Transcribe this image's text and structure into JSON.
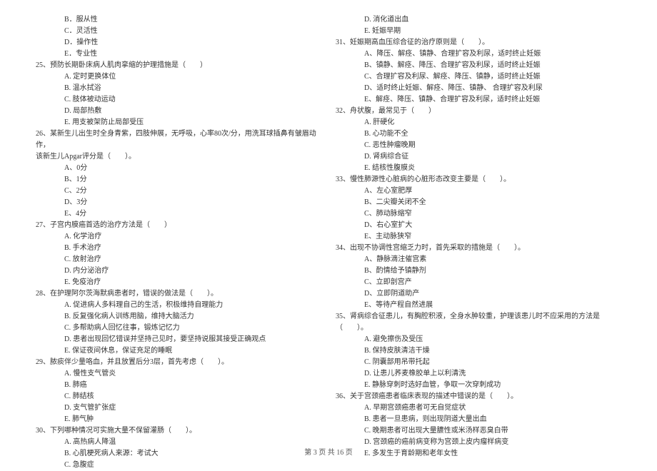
{
  "left_column": {
    "q24_options": [
      "B．服从性",
      "C．灵活性",
      "D．操作性",
      "E．专业性"
    ],
    "q25": {
      "text": "25、预防长期卧床病人肌肉挛缩的护理措施是（　　）",
      "options": [
        "A. 定时更换体位",
        "B. 温水拭浴",
        "C. 肢体被动运动",
        "D. 局部热敷",
        "E. 用支被架防止局部受压"
      ]
    },
    "q26": {
      "text": "26、某新生儿出生时全身青紫，四肢伸展，无呼吸，心率80次/分，用洗耳球插鼻有皱眉动作，",
      "text2": "该新生儿Apgar评分是（　　）。",
      "options": [
        "A、0分",
        "B、1分",
        "C、2分",
        "D、3分",
        "E、4分"
      ]
    },
    "q27": {
      "text": "27、子宫内膜癌首选的治疗方法是（　　）",
      "options": [
        "A. 化学治疗",
        "B. 手术治疗",
        "C. 放射治疗",
        "D. 内分泌治疗",
        "E. 免疫治疗"
      ]
    },
    "q28": {
      "text": "28、在护理阿尔茨海默病患者时，错误的做法是（　　）。",
      "options": [
        "A. 促进病人多料理自己的生活，积极维持自理能力",
        "B. 反复强化病人训练用脑，维持大脑活力",
        "C. 多帮助病人回忆往事，锻炼记忆力",
        "D. 患者出现回忆错误并坚持己见时，要坚持说服其接受正确观点",
        "E. 保证夜间休息，保证充足的睡眠"
      ]
    },
    "q29": {
      "text": "29、脓痰伴少量咯血，并且放置后分3层，首先考虑（　　）。",
      "options": [
        "A. 慢性支气管炎",
        "B. 肺癌",
        "C. 肺结核",
        "D. 支气管扩张症",
        "E. 肺气肿"
      ]
    },
    "q30": {
      "text": "30、下列哪种情况可实施大量不保留灌肠（　　）。",
      "options": [
        "A. 高热病人降温",
        "B. 心肌梗死病人来源：考试大",
        "C. 急腹症"
      ]
    }
  },
  "right_column": {
    "q30_cont": [
      "D. 消化道出血",
      "E. 妊娠早期"
    ],
    "q31": {
      "text": "31、妊娠期高血压综合征的治疗原则是（　　）。",
      "options": [
        "A、降压、解痉、镇静、合理扩容及利尿，适时终止妊娠",
        "B、镇静、解痉、降压、合理扩容及利尿，适时终止妊娠",
        "C、合理扩容及利尿、解痉、降压、镇静，适时终止妊娠",
        "D、适时终止妊娠、解痉、降压、镇静、 合理扩容及利尿",
        "E、解痉、降压、镇静、合理扩容及利尿，适时终止妊娠"
      ]
    },
    "q32": {
      "text": "32、舟状腹，最常见于（　　）",
      "options": [
        "A. 肝硬化",
        "B. 心功能不全",
        "C. 恶性肿瘤晚期",
        "D. 肾病综合征",
        "E. 结核性腹膜炎"
      ]
    },
    "q33": {
      "text": "33、慢性肺源性心脏病的心脏形态改变主要是（　　）。",
      "options": [
        "A、左心室肥厚",
        "B、二尖瓣关闭不全",
        "C、肺动脉缩窄",
        "D、右心室扩大",
        "E、主动脉狭窄"
      ]
    },
    "q34": {
      "text": "34、出现不协调性宫缩乏力时，首先采取的措施是（　　）。",
      "options": [
        "A、静脉滴注催宫素",
        "B、酌情给予镇静剂",
        "C、立即剖宫产",
        "D、立即阴道助产",
        "E、等待产程自然进展"
      ]
    },
    "q35": {
      "text": "35、肾病综合征患儿，有胸腔积液，全身水肿较重，护理该患儿时不应采用的方法是（　　）。",
      "options": [
        "A. 避免擦伤及受压",
        "B. 保持皮肤清洁干燥",
        "C. 阴囊部用吊带托起",
        "D. 让患儿荞麦橡胶单上以利清洗",
        "E. 静脉穿刺时选好血管，争取一次穿刺成功"
      ]
    },
    "q36": {
      "text": "36、关于宫颈癌患者临床表现的描述中错误的是（　　）。",
      "options": [
        "A. 早期宫颈癌患者可无自觉症状",
        "B. 患者一旦患病，则出现阴道大量出血",
        "C. 晚期患者可出现大量膿性或米汤样恶臭白带",
        "D. 宫颈癌的癌前病变称为宫颈上皮内瘤样病变",
        "E. 多发生于育龄期和老年女性"
      ]
    }
  },
  "footer": "第 3 页 共 16 页"
}
